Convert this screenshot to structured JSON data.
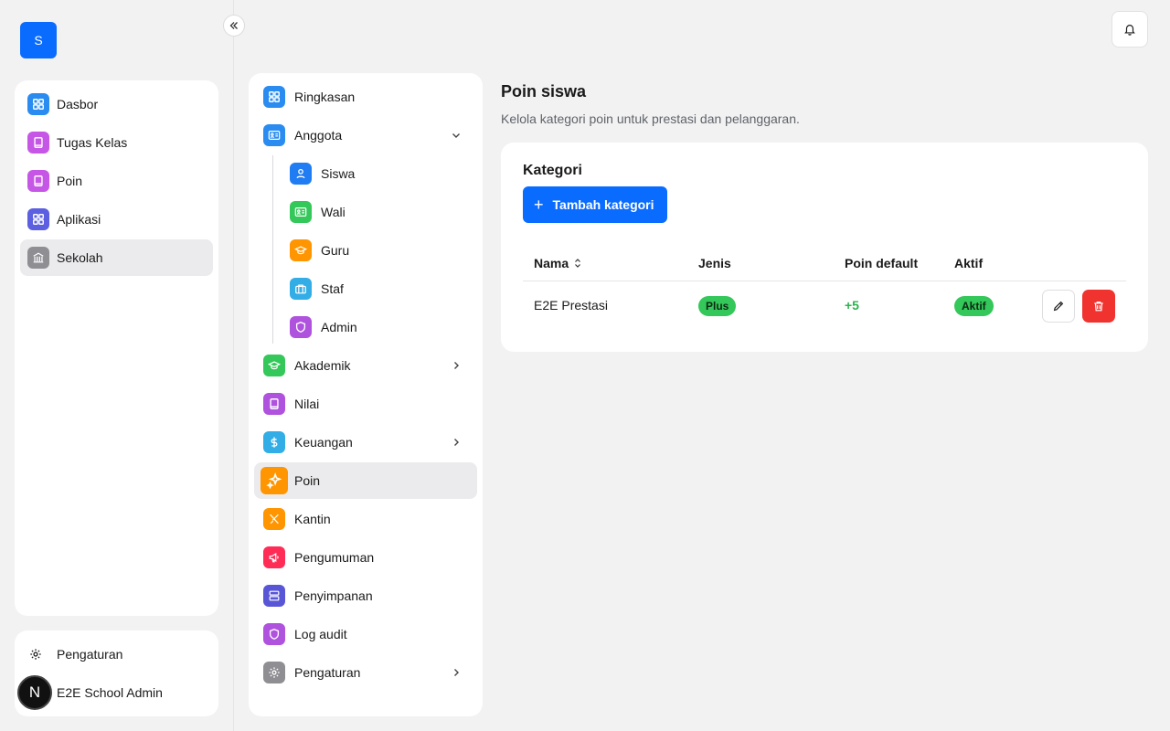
{
  "app": {
    "logo_letter": "S"
  },
  "rail": {
    "items": [
      {
        "label": "Dasbor",
        "icon": "dashboard-icon",
        "color": "#2a8cf0",
        "active": false
      },
      {
        "label": "Tugas Kelas",
        "icon": "book-icon",
        "color": "#c657e6",
        "active": false
      },
      {
        "label": "Poin",
        "icon": "book-icon",
        "color": "#c657e6",
        "active": false
      },
      {
        "label": "Aplikasi",
        "icon": "apps-grid-icon",
        "color": "#5b5fe0",
        "active": false
      },
      {
        "label": "Sekolah",
        "icon": "school-building-icon",
        "color": "#8e8e93",
        "active": true
      }
    ],
    "settings_label": "Pengaturan",
    "user_name": "E2E School Admin",
    "avatar_letter": "N"
  },
  "subnav": {
    "items": [
      {
        "label": "Ringkasan",
        "icon": "dashboard-icon",
        "color": "#2a8cf0"
      },
      {
        "label": "Anggota",
        "icon": "id-card-icon",
        "color": "#2a8cf0"
      },
      {
        "label": "Siswa",
        "icon": "user-icon",
        "color": "#1f7cf2"
      },
      {
        "label": "Wali",
        "icon": "id-card-icon",
        "color": "#34c759"
      },
      {
        "label": "Guru",
        "icon": "graduation-cap-icon",
        "color": "#ff9500"
      },
      {
        "label": "Staf",
        "icon": "briefcase-icon",
        "color": "#32ade6"
      },
      {
        "label": "Admin",
        "icon": "shield-icon",
        "color": "#af52de"
      },
      {
        "label": "Akademik",
        "icon": "graduation-cap-icon",
        "color": "#34c759"
      },
      {
        "label": "Nilai",
        "icon": "book-icon",
        "color": "#af52de"
      },
      {
        "label": "Keuangan",
        "icon": "dollar-icon",
        "color": "#32ade6"
      },
      {
        "label": "Poin",
        "icon": "sparkles-icon",
        "color": "#ff9500"
      },
      {
        "label": "Kantin",
        "icon": "utensils-icon",
        "color": "#ff9500"
      },
      {
        "label": "Pengumuman",
        "icon": "megaphone-icon",
        "color": "#ff2d55"
      },
      {
        "label": "Penyimpanan",
        "icon": "storage-icon",
        "color": "#5856d6"
      },
      {
        "label": "Log audit",
        "icon": "shield-icon",
        "color": "#af52de"
      },
      {
        "label": "Pengaturan",
        "icon": "gear-icon",
        "color": "#8e8e93"
      }
    ]
  },
  "main": {
    "title": "Poin siswa",
    "subtitle": "Kelola kategori poin untuk prestasi dan pelanggaran.",
    "card_title": "Kategori",
    "add_button": "Tambah kategori",
    "columns": [
      "Nama",
      "Jenis",
      "Poin default",
      "Aktif"
    ],
    "rows": [
      {
        "name": "E2E Prestasi",
        "type": "Plus",
        "default_points": "+5",
        "status": "Aktif"
      }
    ]
  },
  "colors": {
    "accent": "#0a6cff",
    "success": "#34c759",
    "danger": "#f0332f"
  }
}
